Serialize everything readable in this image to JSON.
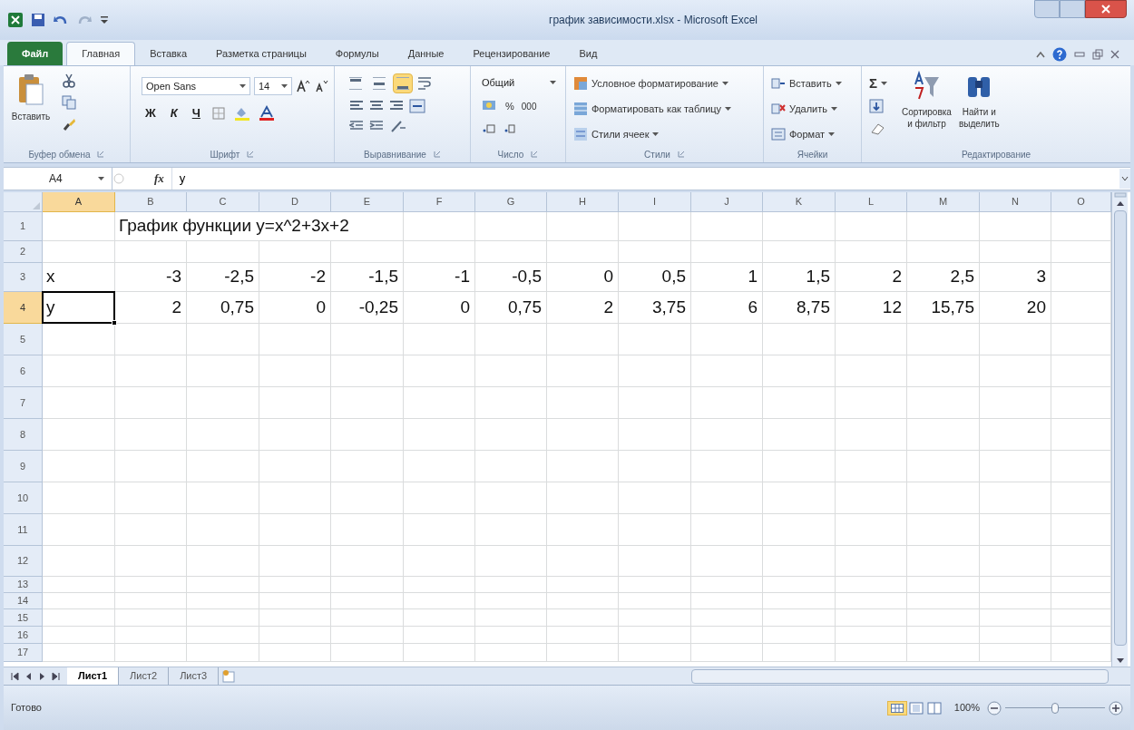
{
  "window": {
    "title": "график зависимости.xlsx - Microsoft Excel"
  },
  "ribbon_tabs": [
    {
      "label": "Файл",
      "kind": "file",
      "selected": false
    },
    {
      "label": "Главная",
      "kind": "tab",
      "selected": true
    },
    {
      "label": "Вставка",
      "kind": "tab",
      "selected": false
    },
    {
      "label": "Разметка страницы",
      "kind": "tab",
      "selected": false
    },
    {
      "label": "Формулы",
      "kind": "tab",
      "selected": false
    },
    {
      "label": "Данные",
      "kind": "tab",
      "selected": false
    },
    {
      "label": "Рецензирование",
      "kind": "tab",
      "selected": false
    },
    {
      "label": "Вид",
      "kind": "tab",
      "selected": false
    }
  ],
  "clipboard": {
    "paste": "Вставить",
    "label": "Буфер обмена"
  },
  "font": {
    "name": "Open Sans",
    "size": "14",
    "bold": "Ж",
    "italic": "К",
    "underline": "Ч",
    "label": "Шрифт"
  },
  "alignment": {
    "vertical": [
      {
        "selected": false
      },
      {
        "selected": false
      },
      {
        "selected": true
      }
    ],
    "label": "Выравнивание"
  },
  "number": {
    "format": "Общий",
    "percent": "%",
    "thousands": "000",
    "label": "Число"
  },
  "styles": {
    "items": [
      "Условное форматирование",
      "Форматировать как таблицу",
      "Стили ячеек"
    ],
    "label": "Стили"
  },
  "cells": {
    "items": [
      "Вставить",
      "Удалить",
      "Формат"
    ],
    "label": "Ячейки"
  },
  "editing": {
    "sum": "Σ",
    "sort": [
      "Сортировка",
      "и фильтр"
    ],
    "find": [
      "Найти и",
      "выделить"
    ],
    "label": "Редактирование"
  },
  "formula_bar": {
    "name_box": "A4",
    "fx": "fx",
    "value": "y"
  },
  "sheet": {
    "columns": [
      {
        "label": "A",
        "selected": true
      },
      {
        "label": "B",
        "selected": false
      },
      {
        "label": "C",
        "selected": false
      },
      {
        "label": "D",
        "selected": false
      },
      {
        "label": "E",
        "selected": false
      },
      {
        "label": "F",
        "selected": false
      },
      {
        "label": "G",
        "selected": false
      },
      {
        "label": "H",
        "selected": false
      },
      {
        "label": "I",
        "selected": false
      },
      {
        "label": "J",
        "selected": false
      },
      {
        "label": "K",
        "selected": false
      },
      {
        "label": "L",
        "selected": false
      },
      {
        "label": "M",
        "selected": false
      },
      {
        "label": "N",
        "selected": false
      },
      {
        "label": "O",
        "selected": false
      }
    ],
    "rows": [
      {
        "label": "1",
        "selected": false,
        "cells": [
          {},
          {
            "text": "График функции y=x^2+3x+2",
            "kind": "text"
          }
        ]
      },
      {
        "label": "2",
        "selected": false,
        "cells": []
      },
      {
        "label": "3",
        "selected": false,
        "cells": [
          {
            "text": "x",
            "kind": "text"
          },
          {
            "text": "-3",
            "kind": "number"
          },
          {
            "text": "-2,5",
            "kind": "number"
          },
          {
            "text": "-2",
            "kind": "number"
          },
          {
            "text": "-1,5",
            "kind": "number"
          },
          {
            "text": "-1",
            "kind": "number"
          },
          {
            "text": "-0,5",
            "kind": "number"
          },
          {
            "text": "0",
            "kind": "number"
          },
          {
            "text": "0,5",
            "kind": "number"
          },
          {
            "text": "1",
            "kind": "number"
          },
          {
            "text": "1,5",
            "kind": "number"
          },
          {
            "text": "2",
            "kind": "number"
          },
          {
            "text": "2,5",
            "kind": "number"
          },
          {
            "text": "3",
            "kind": "number"
          }
        ]
      },
      {
        "label": "4",
        "selected": true,
        "cells": [
          {
            "text": "y",
            "kind": "text"
          },
          {
            "text": "2",
            "kind": "number"
          },
          {
            "text": "0,75",
            "kind": "number"
          },
          {
            "text": "0",
            "kind": "number"
          },
          {
            "text": "-0,25",
            "kind": "number"
          },
          {
            "text": "0",
            "kind": "number"
          },
          {
            "text": "0,75",
            "kind": "number"
          },
          {
            "text": "2",
            "kind": "number"
          },
          {
            "text": "3,75",
            "kind": "number"
          },
          {
            "text": "6",
            "kind": "number"
          },
          {
            "text": "8,75",
            "kind": "number"
          },
          {
            "text": "12",
            "kind": "number"
          },
          {
            "text": "15,75",
            "kind": "number"
          },
          {
            "text": "20",
            "kind": "number"
          }
        ]
      },
      {
        "label": "5",
        "selected": false,
        "cells": []
      },
      {
        "label": "6",
        "selected": false,
        "cells": []
      },
      {
        "label": "7",
        "selected": false,
        "cells": []
      },
      {
        "label": "8",
        "selected": false,
        "cells": []
      },
      {
        "label": "9",
        "selected": false,
        "cells": []
      },
      {
        "label": "10",
        "selected": false,
        "cells": []
      },
      {
        "label": "11",
        "selected": false,
        "cells": []
      },
      {
        "label": "12",
        "selected": false,
        "cells": []
      },
      {
        "label": "13",
        "selected": false,
        "cells": []
      },
      {
        "label": "14",
        "selected": false,
        "cells": []
      },
      {
        "label": "15",
        "selected": false,
        "cells": []
      },
      {
        "label": "16",
        "selected": false,
        "cells": []
      },
      {
        "label": "17",
        "selected": false,
        "cells": []
      }
    ]
  },
  "sheet_tabs": [
    {
      "label": "Лист1",
      "selected": true
    },
    {
      "label": "Лист2",
      "selected": false
    },
    {
      "label": "Лист3",
      "selected": false
    }
  ],
  "status_bar": {
    "text": "Готово",
    "zoom": "100%",
    "level": 0.5
  }
}
